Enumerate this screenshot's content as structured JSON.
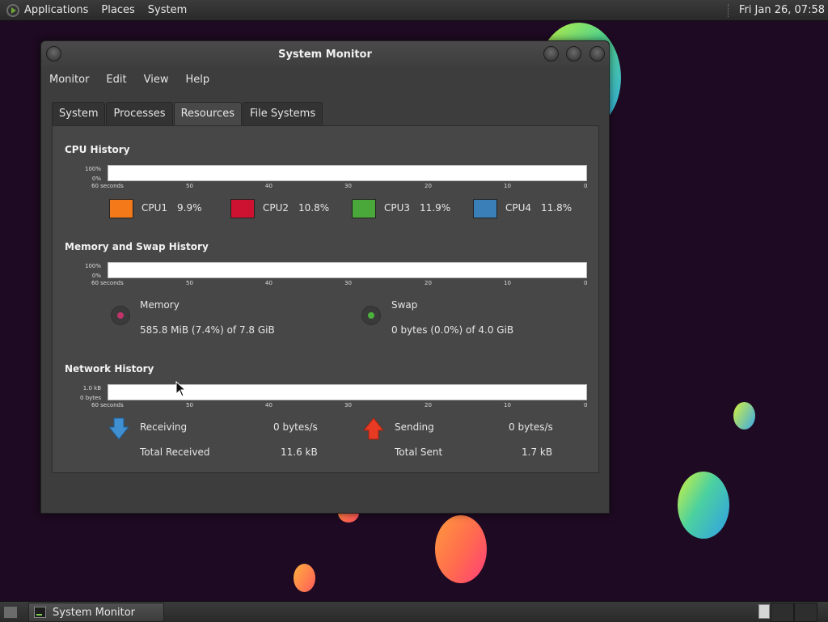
{
  "top_panel": {
    "menus": [
      "Applications",
      "Places",
      "System"
    ],
    "clock": "Fri Jan 26, 07:58"
  },
  "window": {
    "title": "System Monitor",
    "menubar": [
      "Monitor",
      "Edit",
      "View",
      "Help"
    ],
    "tabs": [
      {
        "label": "System",
        "active": false
      },
      {
        "label": "Processes",
        "active": false
      },
      {
        "label": "Resources",
        "active": true
      },
      {
        "label": "File Systems",
        "active": false
      }
    ],
    "graph_x_labels": [
      "60 seconds",
      "50",
      "40",
      "30",
      "20",
      "10",
      "0"
    ],
    "cpu": {
      "title": "CPU History",
      "y_top": "100%",
      "y_bottom": "0%",
      "items": [
        {
          "name": "CPU1",
          "value": "9.9%",
          "color": "#f47a19"
        },
        {
          "name": "CPU2",
          "value": "10.8%",
          "color": "#cc1230"
        },
        {
          "name": "CPU3",
          "value": "11.9%",
          "color": "#4aa83a"
        },
        {
          "name": "CPU4",
          "value": "11.8%",
          "color": "#3a7fb8"
        }
      ]
    },
    "memory": {
      "title": "Memory and Swap History",
      "y_top": "100%",
      "y_bottom": "0%",
      "memory_label": "Memory",
      "memory_value": "585.8 MiB (7.4%) of 7.8 GiB",
      "memory_color": "#c0336a",
      "swap_label": "Swap",
      "swap_value": "0 bytes (0.0%) of 4.0 GiB",
      "swap_color": "#4cb03c"
    },
    "network": {
      "title": "Network History",
      "y_top": "1.0 kB",
      "y_bottom": "0 bytes",
      "receiving_label": "Receiving",
      "receiving_value": "0 bytes/s",
      "total_received_label": "Total Received",
      "total_received_value": "11.6 kB",
      "sending_label": "Sending",
      "sending_value": "0 bytes/s",
      "total_sent_label": "Total Sent",
      "total_sent_value": "1.7 kB"
    }
  },
  "taskbar": {
    "task_label": "System Monitor"
  }
}
